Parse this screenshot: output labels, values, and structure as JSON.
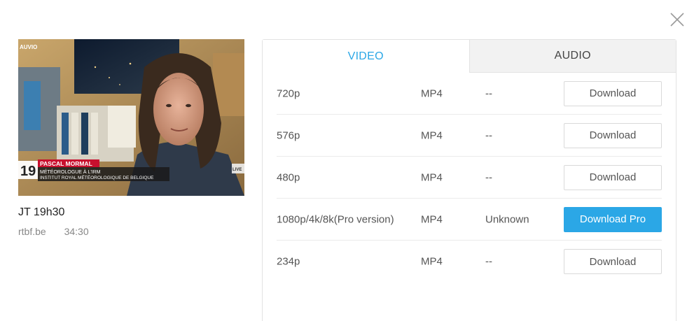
{
  "video": {
    "title": "JT 19h30",
    "source": "rtbf.be",
    "duration": "34:30",
    "overlay": {
      "channel_badge": "19",
      "lower_third_name": "PASCAL MORMAL",
      "lower_third_line1": "MÉTÉOROLOGUE À L'IRM",
      "lower_third_line2": "INSTITUT ROYAL MÉTÉOROLOGIQUE DE BELGIQUE",
      "corner_logo": "AUVIO",
      "side_tag": "LIVE"
    }
  },
  "tabs": [
    {
      "label": "VIDEO",
      "active": true
    },
    {
      "label": "AUDIO",
      "active": false
    }
  ],
  "formats": [
    {
      "resolution": "720p",
      "format": "MP4",
      "size": "--",
      "action": "Download",
      "pro": false
    },
    {
      "resolution": "576p",
      "format": "MP4",
      "size": "--",
      "action": "Download",
      "pro": false
    },
    {
      "resolution": "480p",
      "format": "MP4",
      "size": "--",
      "action": "Download",
      "pro": false
    },
    {
      "resolution": "1080p/4k/8k(Pro version)",
      "format": "MP4",
      "size": "Unknown",
      "action": "Download Pro",
      "pro": true
    },
    {
      "resolution": "234p",
      "format": "MP4",
      "size": "--",
      "action": "Download",
      "pro": false
    }
  ],
  "colors": {
    "accent": "#2ba7e6",
    "lower_third_red": "#c8102e"
  },
  "icons": {
    "close": "close-icon"
  }
}
